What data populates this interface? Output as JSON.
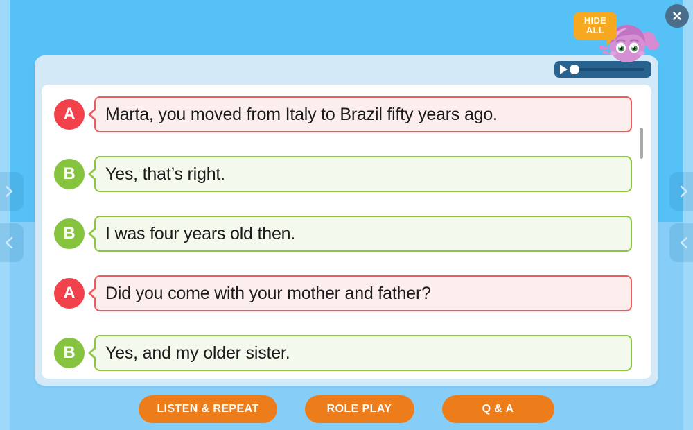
{
  "background": {
    "color_top": "#55c1f6",
    "color_bottom": "#86cef7"
  },
  "close_button": {
    "icon": "close-icon",
    "label": "✕"
  },
  "mascot": {
    "name": "octopus-character",
    "bubble": {
      "line1": "HIDE",
      "line2": "ALL",
      "color": "#f6a821"
    }
  },
  "player": {
    "play_icon": "play-icon",
    "progress_percent": 5
  },
  "dialogue": {
    "scrollbar": "visible",
    "lines": [
      {
        "speaker": "A",
        "speaker_color": "#f1414a",
        "text": "Marta, you moved from Italy to Brazil fifty years ago."
      },
      {
        "speaker": "B",
        "speaker_color": "#86c440",
        "text": "Yes, that’s right."
      },
      {
        "speaker": "B",
        "speaker_color": "#86c440",
        "text": "I was four years old then."
      },
      {
        "speaker": "A",
        "speaker_color": "#f1414a",
        "text": "Did you come with your mother and father?"
      },
      {
        "speaker": "B",
        "speaker_color": "#86c440",
        "text": "Yes, and my older sister."
      }
    ]
  },
  "actions": {
    "listen_repeat": "LISTEN & REPEAT",
    "role_play": "ROLE PLAY",
    "qa": "Q & A",
    "color": "#ed7d1a"
  },
  "side_nav": {
    "next_icon": "chevron-right-icon",
    "prev_icon": "chevron-left-icon"
  }
}
